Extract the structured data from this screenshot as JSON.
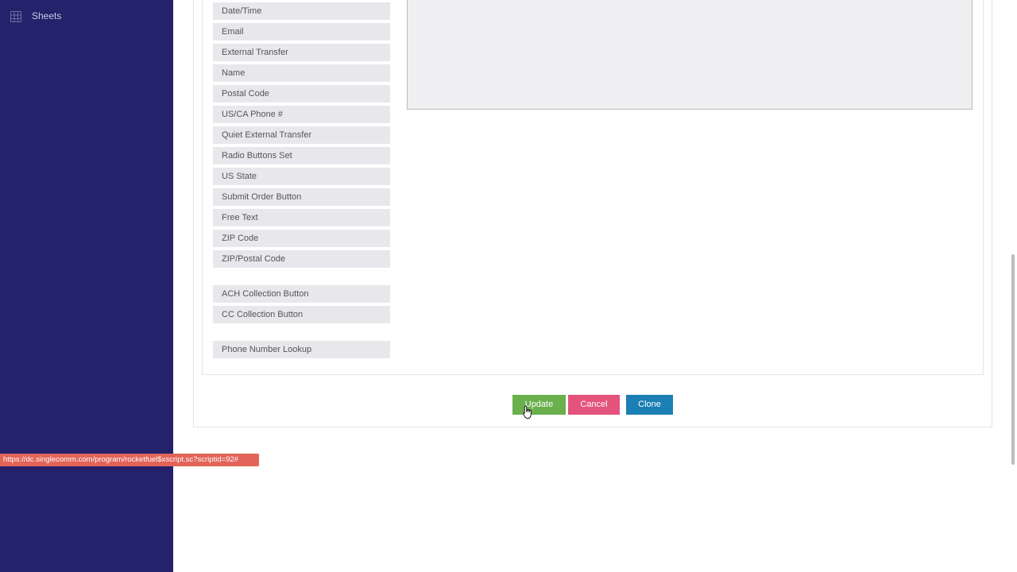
{
  "sidebar": {
    "items": [
      {
        "label": "Sheets",
        "icon": "grid-icon"
      }
    ]
  },
  "fields": [
    {
      "label": "Date/Time"
    },
    {
      "label": "Email"
    },
    {
      "label": "External Transfer"
    },
    {
      "label": "Name"
    },
    {
      "label": "Postal Code"
    },
    {
      "label": "US/CA Phone #"
    },
    {
      "label": "Quiet External Transfer"
    },
    {
      "label": "Radio Buttons Set"
    },
    {
      "label": "US State"
    },
    {
      "label": "Submit Order Button"
    },
    {
      "label": "Free Text"
    },
    {
      "label": "ZIP Code"
    },
    {
      "label": "ZIP/Postal Code"
    },
    {
      "label": "ACH Collection Button"
    },
    {
      "label": "CC Collection Button"
    },
    {
      "label": "Phone Number Lookup"
    }
  ],
  "actions": {
    "update_label": "Update",
    "cancel_label": "Cancel",
    "clone_label": "Clone"
  },
  "status_bar": {
    "url": "https://dc.singlecomm.com/program/rocketfuel$xscript.sc?scriptid=92#"
  },
  "colors": {
    "sidebar_bg": "#23226a",
    "update": "#6ab04c",
    "cancel": "#e4537b",
    "clone": "#1b7fb3",
    "status_bg": "#e26459"
  }
}
